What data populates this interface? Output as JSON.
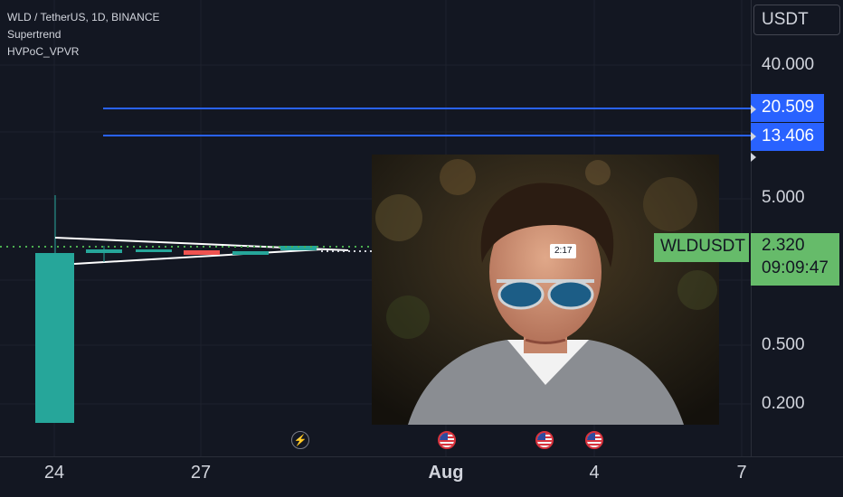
{
  "header": {
    "symbol_line": "WLD / TetherUS, 1D, BINANCE",
    "indicator_1": "Supertrend",
    "indicator_2": "HVPoC_VPVR"
  },
  "price_axis": {
    "currency": "USDT",
    "labels": [
      "40.000",
      "5.000",
      "0.500",
      "0.200"
    ]
  },
  "price_tags": {
    "level_1": "20.509",
    "level_2": "13.406",
    "symbol": "WLDUSDT",
    "last_price": "2.320",
    "countdown": "09:09:47"
  },
  "time_axis": {
    "labels": [
      "24",
      "27",
      "Aug",
      "4",
      "7"
    ]
  },
  "overlay": {
    "label": "2:17"
  },
  "colors": {
    "background": "#131722",
    "bull": "#26a69a",
    "bear": "#ef5350",
    "level_line": "#2962ff",
    "price_tag": "#66bb6a",
    "dotted_line": "#4caf50"
  },
  "icons": {
    "event_icon": "lightning-bolt-icon",
    "economic_event_icon": "us-flag-icon"
  }
}
